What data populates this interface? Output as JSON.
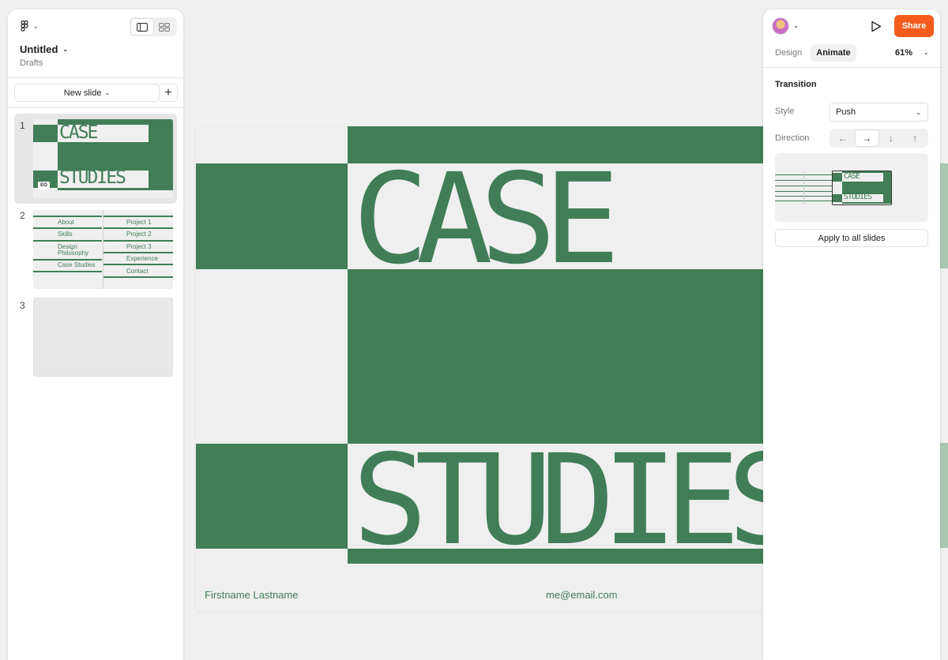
{
  "file": {
    "title": "Untitled",
    "location": "Drafts"
  },
  "slides_panel": {
    "new_slide_label": "New slide",
    "slides": [
      {
        "number": "1",
        "title_top": "CASE",
        "title_bottom": "STUDIES",
        "badge": "EO"
      },
      {
        "number": "2",
        "left_items": [
          "About",
          "Skills",
          "Design Philosophy",
          "Case Studies"
        ],
        "right_items": [
          "Project 1",
          "Project 2",
          "Project 3",
          "Experience",
          "Contact"
        ]
      },
      {
        "number": "3"
      }
    ]
  },
  "canvas": {
    "slide_title_top": "CASE",
    "slide_title_bottom": "STUDIES",
    "footer_name": "Firstname Lastname",
    "footer_email": "me@email.com",
    "accent_color": "#417e58"
  },
  "properties": {
    "share_label": "Share",
    "tabs": [
      "Design",
      "Animate"
    ],
    "active_tab": "Animate",
    "zoom": "61%",
    "section_title": "Transition",
    "style_label": "Style",
    "style_value": "Push",
    "direction_label": "Direction",
    "directions": [
      "←",
      "→",
      "↓",
      "↑"
    ],
    "active_direction": "→",
    "preview_top": "CASE",
    "preview_bottom": "STUDIES",
    "apply_label": "Apply to all slides",
    "share_color": "#f35b1c"
  }
}
